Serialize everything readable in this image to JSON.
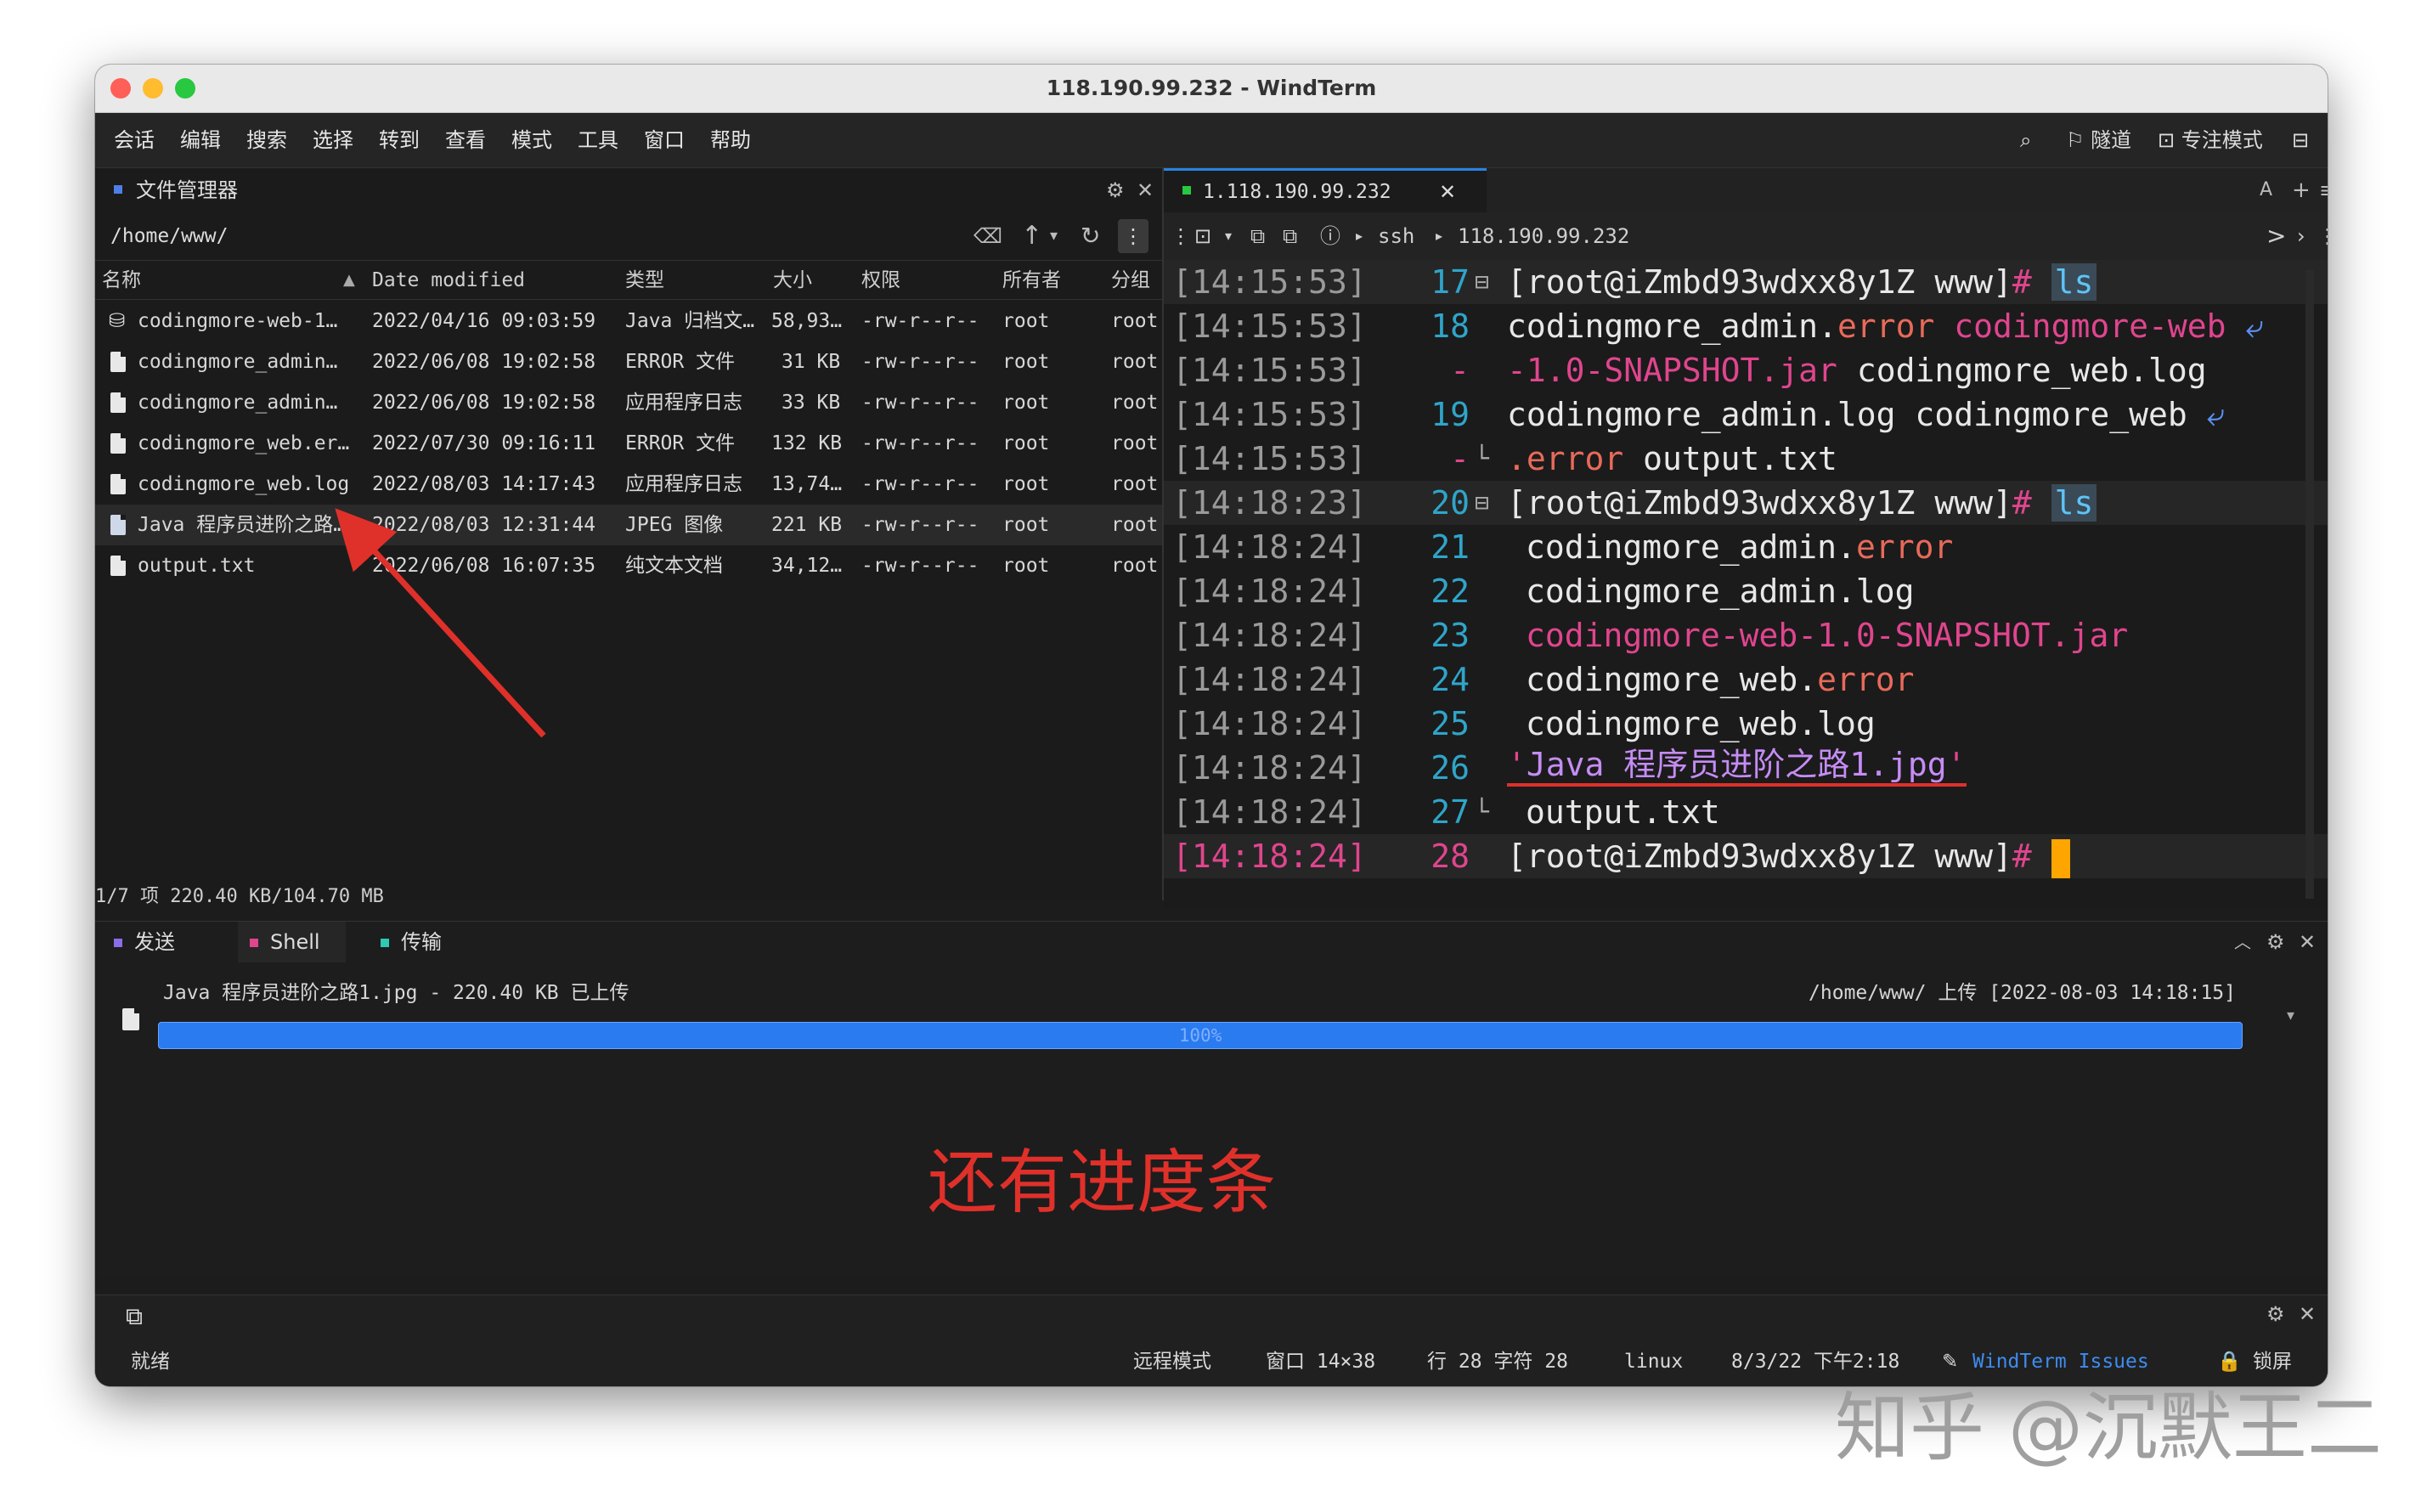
{
  "window": {
    "title": "118.190.99.232 - WindTerm"
  },
  "menu": [
    "会话",
    "编辑",
    "搜索",
    "选择",
    "转到",
    "查看",
    "模式",
    "工具",
    "窗口",
    "帮助"
  ],
  "menu_right": {
    "tunnel": "隧道",
    "focus": "专注模式"
  },
  "file_manager": {
    "title": "文件管理器",
    "path": "/home/www/",
    "columns": [
      "名称",
      "Date modified",
      "类型",
      "大小",
      "权限",
      "所有者",
      "分组"
    ],
    "rows": [
      {
        "name": "codingmore-web-1…",
        "date": "2022/04/16 09:03:59",
        "type": "Java 归档文…",
        "size": "58,93…",
        "perm": "-rw-r--r--",
        "owner": "root",
        "group": "root"
      },
      {
        "name": "codingmore_admin…",
        "date": "2022/06/08 19:02:58",
        "type": "ERROR 文件",
        "size": "31 KB",
        "perm": "-rw-r--r--",
        "owner": "root",
        "group": "root"
      },
      {
        "name": "codingmore_admin…",
        "date": "2022/06/08 19:02:58",
        "type": "应用程序日志",
        "size": "33 KB",
        "perm": "-rw-r--r--",
        "owner": "root",
        "group": "root"
      },
      {
        "name": "codingmore_web.er…",
        "date": "2022/07/30 09:16:11",
        "type": "ERROR 文件",
        "size": "132 KB",
        "perm": "-rw-r--r--",
        "owner": "root",
        "group": "root"
      },
      {
        "name": "codingmore_web.log",
        "date": "2022/08/03 14:17:43",
        "type": "应用程序日志",
        "size": "13,74…",
        "perm": "-rw-r--r--",
        "owner": "root",
        "group": "root"
      },
      {
        "name": "Java 程序员进阶之路…",
        "date": "2022/08/03 12:31:44",
        "type": "JPEG 图像",
        "size": "221 KB",
        "perm": "-rw-r--r--",
        "owner": "root",
        "group": "root"
      },
      {
        "name": "output.txt",
        "date": "2022/06/08 16:07:35",
        "type": "纯文本文档",
        "size": "34,12…",
        "perm": "-rw-r--r--",
        "owner": "root",
        "group": "root"
      }
    ],
    "status": "1/7 项 220.40 KB/104.70 MB"
  },
  "terminal": {
    "tab": "1.118.190.99.232",
    "ssh": "ssh",
    "host": "118.190.99.232",
    "lines": [
      {
        "ts": "[14:15:53]",
        "ln": "17",
        "fold": "⊟",
        "parts": [
          [
            "",
            "[root@iZmbd93wdxx8y1Z www]"
          ],
          [
            "pink",
            "# "
          ],
          [
            "cmd",
            "ls"
          ]
        ]
      },
      {
        "ts": "[14:15:53]",
        "ln": "18",
        "fold": "",
        "parts": [
          [
            "",
            "codingmore_admin."
          ],
          [
            "red",
            "error"
          ],
          [
            "",
            "  "
          ],
          [
            "pink",
            "codingmore-web"
          ],
          [
            "blue",
            " ⤶"
          ]
        ]
      },
      {
        "ts": "[14:15:53]",
        "ln": "-",
        "fold": "",
        "parts": [
          [
            "pink",
            "-1.0-SNAPSHOT.jar"
          ],
          [
            "",
            "  codingmore_web.log"
          ]
        ]
      },
      {
        "ts": "[14:15:53]",
        "ln": "19",
        "fold": "",
        "parts": [
          [
            "",
            "codingmore_admin.log    codingmore_web"
          ],
          [
            "blue",
            " ⤶"
          ]
        ]
      },
      {
        "ts": "[14:15:53]",
        "ln": "-",
        "fold": "└",
        "parts": [
          [
            "red",
            ".error"
          ],
          [
            "",
            "               output.txt"
          ]
        ]
      },
      {
        "ts": "[14:18:23]",
        "ln": "20",
        "fold": "⊟",
        "parts": [
          [
            "",
            "[root@iZmbd93wdxx8y1Z www]"
          ],
          [
            "pink",
            "# "
          ],
          [
            "cmd",
            "ls"
          ]
        ]
      },
      {
        "ts": "[14:18:24]",
        "ln": "21",
        "fold": "",
        "parts": [
          [
            "",
            "codingmore_admin."
          ],
          [
            "red",
            "error"
          ]
        ]
      },
      {
        "ts": "[14:18:24]",
        "ln": "22",
        "fold": "",
        "parts": [
          [
            "",
            "codingmore_admin.log"
          ]
        ]
      },
      {
        "ts": "[14:18:24]",
        "ln": "23",
        "fold": "",
        "parts": [
          [
            "pink",
            "codingmore-web-1.0-SNAPSHOT.jar"
          ]
        ]
      },
      {
        "ts": "[14:18:24]",
        "ln": "24",
        "fold": "",
        "parts": [
          [
            "",
            "codingmore_web."
          ],
          [
            "red",
            "error"
          ]
        ]
      },
      {
        "ts": "[14:18:24]",
        "ln": "25",
        "fold": "",
        "parts": [
          [
            "",
            "codingmore_web.log"
          ]
        ]
      },
      {
        "ts": "[14:18:24]",
        "ln": "26",
        "fold": "",
        "parts": [
          [
            "pink",
            "'"
          ],
          [
            "violet",
            "Java 程序员进阶之路1.jpg"
          ],
          [
            "pink",
            "'"
          ]
        ]
      },
      {
        "ts": "[14:18:24]",
        "ln": "27",
        "fold": "└",
        "parts": [
          [
            "",
            "output.txt"
          ]
        ]
      },
      {
        "ts": "[14:18:24]",
        "ln": "28",
        "fold": "",
        "parts": [
          [
            "",
            "[root@iZmbd93wdxx8y1Z www]"
          ],
          [
            "pink",
            "# "
          ],
          [
            "cursor",
            ""
          ]
        ]
      }
    ]
  },
  "bottom": {
    "tabs": [
      "发送",
      "Shell",
      "传输"
    ],
    "transfer_text": "Java 程序员进阶之路1.jpg - 220.40 KB 已上传",
    "transfer_right": "/home/www/ 上传 [2022-08-03 14:18:15]",
    "progress_label": "100%",
    "progress": 1.0,
    "annotation": "还有进度条"
  },
  "statusbar": {
    "ready": "就绪",
    "mode": "远程模式",
    "window": "窗口 14×38",
    "pos": "行 28 字符 28",
    "os": "linux",
    "time": "8/3/22 下午2:18",
    "issues": "WindTerm Issues",
    "lock": "锁屏"
  },
  "watermark": "知乎 @沉默王二",
  "colors": {
    "accent": "#2a7bf0",
    "annotation": "#e0302a",
    "cursor": "#ffa500"
  }
}
